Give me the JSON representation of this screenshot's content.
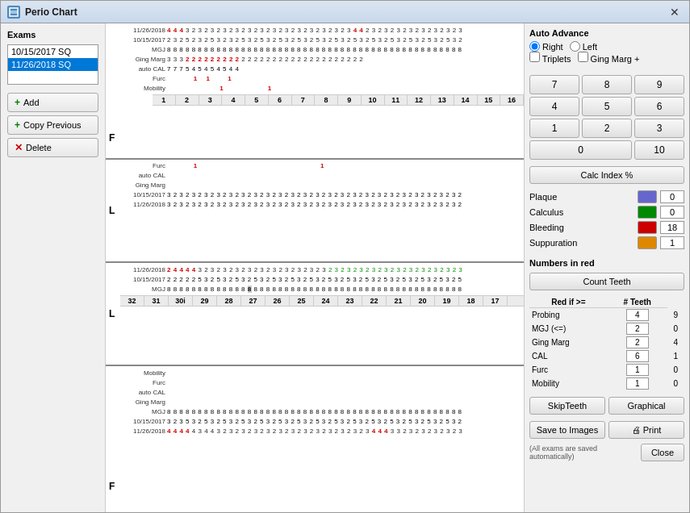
{
  "window": {
    "title": "Perio Chart",
    "icon": "⊞",
    "close_button": "✕"
  },
  "sidebar": {
    "exams_label": "Exams",
    "exam_items": [
      {
        "label": "10/15/2017  SQ",
        "selected": false
      },
      {
        "label": "11/26/2018  SQ",
        "selected": true
      }
    ],
    "buttons": [
      {
        "icon": "+",
        "label": "Add",
        "color": "green"
      },
      {
        "icon": "+",
        "label": "Copy Previous",
        "color": "green"
      },
      {
        "icon": "✕",
        "label": "Delete",
        "color": "red"
      }
    ]
  },
  "right_panel": {
    "auto_advance": {
      "title": "Auto Advance",
      "right_label": "Right",
      "left_label": "Left",
      "triplets_label": "Triplets",
      "ging_marg_label": "Ging Marg +"
    },
    "numpad": [
      "7",
      "8",
      "9",
      "4",
      "5",
      "6",
      "1",
      "2",
      "3",
      "0",
      "10"
    ],
    "calc_index_label": "Calc Index %",
    "indices": [
      {
        "name": "Plaque",
        "color": "#6666cc",
        "value": "0"
      },
      {
        "name": "Calculus",
        "color": "#008800",
        "value": "0"
      },
      {
        "name": "Bleeding",
        "color": "#cc0000",
        "value": "18"
      },
      {
        "name": "Suppuration",
        "color": "#dd8800",
        "value": "1"
      }
    ],
    "numbers_in_red": "Numbers in red",
    "count_teeth_label": "Count Teeth",
    "red_table_headers": [
      "Red if >=",
      "# Teeth"
    ],
    "red_table_rows": [
      {
        "name": "Probing",
        "value": "4",
        "teeth": "9"
      },
      {
        "name": "MGJ (<=)",
        "value": "2",
        "teeth": "0"
      },
      {
        "name": "Ging Marg",
        "value": "2",
        "teeth": "4"
      },
      {
        "name": "CAL",
        "value": "6",
        "teeth": "1"
      },
      {
        "name": "Furc",
        "value": "1",
        "teeth": "0"
      },
      {
        "name": "Mobility",
        "value": "1",
        "teeth": "0"
      }
    ],
    "skip_teeth_label": "SkipTeeth",
    "graphical_label": "Graphical",
    "save_to_images_label": "Save to Images",
    "print_label": "🖨 Print",
    "auto_note": "(All exams are saved automatically)",
    "close_label": "Close"
  },
  "chart": {
    "upper_right": {
      "date1": "11/26/2018",
      "date2": "10/15/2017",
      "tooth_numbers": [
        "1",
        "2",
        "3",
        "4",
        "5",
        "6",
        "7",
        "8",
        "9",
        "10",
        "11",
        "12",
        "13",
        "14",
        "15",
        "16"
      ],
      "rows": {
        "probing1": "4 4 4 3 2 3 2 3 2 3 2  3 2 3 2 3 2 3 2 3 2 3 2 3 2 3 2 3 4 4 2 3",
        "probing2": "2 3 2 5 2 3 2 5 3 2 3  2 5 3 2 5 3 2 5 3 2 5 3 2 5 3 2 5 3 2 5 3",
        "mgj": "8 8 8 8 8 8 8 8 8 8 8 8 8 8 8 8 8 8 8 8 8 8 8 8 8 8 8 8 8 8 8 8",
        "ging_marg": "3 3 3 2 2 2 2 2 2 2 2 2 2 2 2 2 2 2 2 2 2 2 2 2 2 2 2 2 2 2 2 2",
        "auto_cal": "7 7 7 5 4 5 4 5 4 5 4 4",
        "furc": "1 1 1 1",
        "mobility": "1 1"
      }
    },
    "lower_right": {
      "date1": "10/15/2017",
      "date2": "11/26/2018",
      "tooth_numbers": [
        "32",
        "31",
        "30i",
        "29",
        "28",
        "27",
        "26",
        "25",
        "24",
        "23",
        "22",
        "21",
        "20",
        "19",
        "18",
        "17"
      ],
      "rows": {
        "furc": "",
        "auto_cal": "",
        "ging_marg": ""
      }
    },
    "lower_left": {
      "date1": "11/26/2018",
      "date2": "10/15/2017",
      "tooth_numbers": [
        "32",
        "31",
        "30i",
        "29",
        "28",
        "27",
        "26",
        "25",
        "24",
        "23",
        "22",
        "21",
        "20",
        "19",
        "18",
        "17"
      ]
    }
  }
}
